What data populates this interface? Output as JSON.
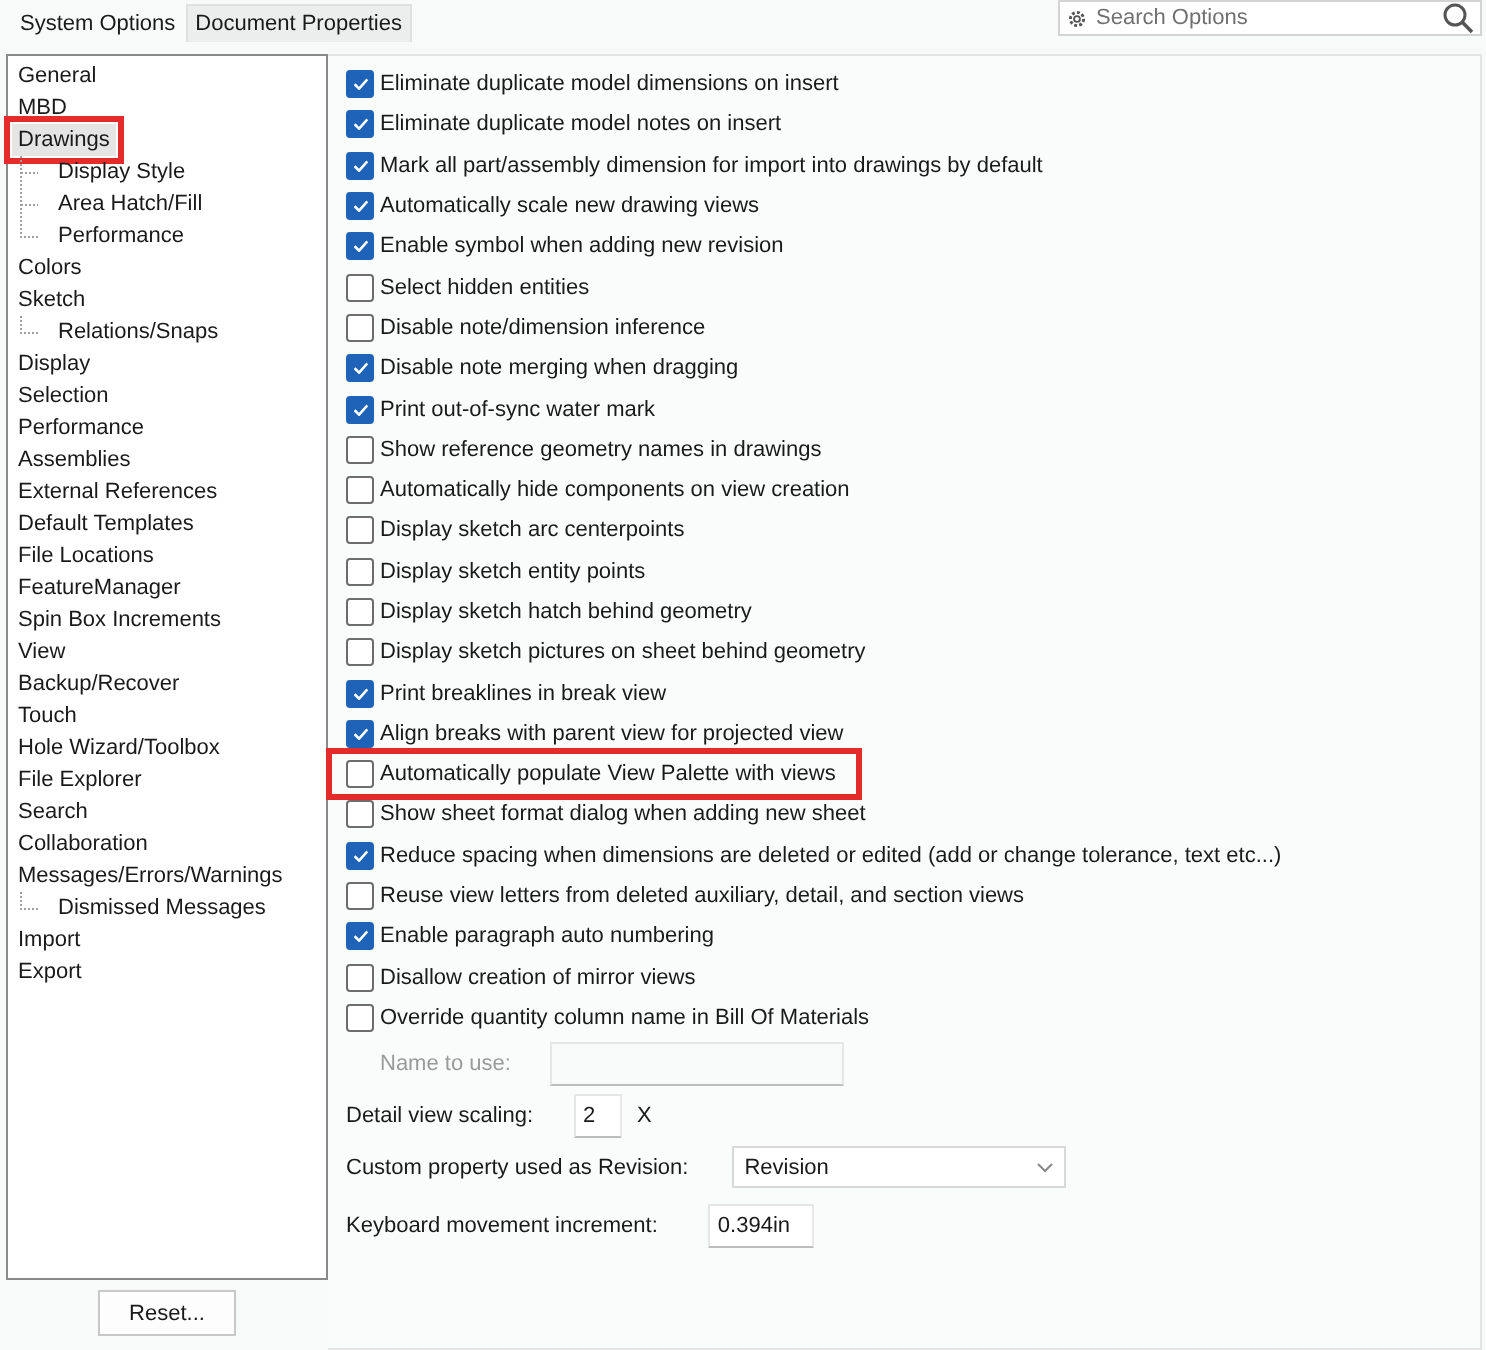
{
  "tabs": [
    {
      "label": "System Options",
      "selected": true
    },
    {
      "label": "Document Properties",
      "selected": false
    }
  ],
  "search": {
    "placeholder": "Search Options"
  },
  "sidebar": {
    "items": [
      {
        "label": "General",
        "selected": false,
        "highlighted": false
      },
      {
        "label": "MBD",
        "selected": false,
        "highlighted": false
      },
      {
        "label": "Drawings",
        "selected": true,
        "highlighted": true,
        "children": [
          {
            "label": "Display Style",
            "selected": false,
            "highlighted": false
          },
          {
            "label": "Area Hatch/Fill",
            "selected": false,
            "highlighted": false
          },
          {
            "label": "Performance",
            "selected": false,
            "highlighted": false
          }
        ]
      },
      {
        "label": "Colors",
        "selected": false,
        "highlighted": false
      },
      {
        "label": "Sketch",
        "selected": false,
        "highlighted": false,
        "children": [
          {
            "label": "Relations/Snaps",
            "selected": false,
            "highlighted": false
          }
        ]
      },
      {
        "label": "Display",
        "selected": false,
        "highlighted": false
      },
      {
        "label": "Selection",
        "selected": false,
        "highlighted": false
      },
      {
        "label": "Performance",
        "selected": false,
        "highlighted": false
      },
      {
        "label": "Assemblies",
        "selected": false,
        "highlighted": false
      },
      {
        "label": "External References",
        "selected": false,
        "highlighted": false
      },
      {
        "label": "Default Templates",
        "selected": false,
        "highlighted": false
      },
      {
        "label": "File Locations",
        "selected": false,
        "highlighted": false
      },
      {
        "label": "FeatureManager",
        "selected": false,
        "highlighted": false
      },
      {
        "label": "Spin Box Increments",
        "selected": false,
        "highlighted": false
      },
      {
        "label": "View",
        "selected": false,
        "highlighted": false
      },
      {
        "label": "Backup/Recover",
        "selected": false,
        "highlighted": false
      },
      {
        "label": "Touch",
        "selected": false,
        "highlighted": false
      },
      {
        "label": "Hole Wizard/Toolbox",
        "selected": false,
        "highlighted": false
      },
      {
        "label": "File Explorer",
        "selected": false,
        "highlighted": false
      },
      {
        "label": "Search",
        "selected": false,
        "highlighted": false
      },
      {
        "label": "Collaboration",
        "selected": false,
        "highlighted": false
      },
      {
        "label": "Messages/Errors/Warnings",
        "selected": false,
        "highlighted": false,
        "children": [
          {
            "label": "Dismissed Messages",
            "selected": false,
            "highlighted": false
          }
        ]
      },
      {
        "label": "Import",
        "selected": false,
        "highlighted": false
      },
      {
        "label": "Export",
        "selected": false,
        "highlighted": false
      }
    ]
  },
  "options": [
    {
      "label": "Eliminate duplicate model dimensions on insert",
      "checked": true,
      "highlighted": false
    },
    {
      "label": "Eliminate duplicate model notes on insert",
      "checked": true,
      "highlighted": false
    },
    {
      "label": "Mark all part/assembly dimension for import into drawings by default",
      "checked": true,
      "highlighted": false
    },
    {
      "label": "Automatically scale new drawing views",
      "checked": true,
      "highlighted": false
    },
    {
      "label": "Enable symbol when adding new revision",
      "checked": true,
      "highlighted": false
    },
    {
      "label": "Select hidden entities",
      "checked": false,
      "highlighted": false
    },
    {
      "label": "Disable note/dimension inference",
      "checked": false,
      "highlighted": false
    },
    {
      "label": "Disable note merging when dragging",
      "checked": true,
      "highlighted": false
    },
    {
      "label": "Print out-of-sync water mark",
      "checked": true,
      "highlighted": false
    },
    {
      "label": "Show reference geometry names in drawings",
      "checked": false,
      "highlighted": false
    },
    {
      "label": "Automatically hide components on view creation",
      "checked": false,
      "highlighted": false
    },
    {
      "label": "Display sketch arc centerpoints",
      "checked": false,
      "highlighted": false
    },
    {
      "label": "Display sketch entity points",
      "checked": false,
      "highlighted": false
    },
    {
      "label": "Display sketch hatch behind geometry",
      "checked": false,
      "highlighted": false
    },
    {
      "label": "Display sketch pictures on sheet behind geometry",
      "checked": false,
      "highlighted": false
    },
    {
      "label": "Print breaklines in break view",
      "checked": true,
      "highlighted": false
    },
    {
      "label": "Align breaks with parent view for projected view",
      "checked": true,
      "highlighted": false
    },
    {
      "label": "Automatically populate View Palette with views",
      "checked": false,
      "highlighted": true
    },
    {
      "label": "Show sheet format dialog when adding new sheet",
      "checked": false,
      "highlighted": false
    },
    {
      "label": "Reduce spacing when dimensions are deleted or edited (add or change tolerance, text etc...)",
      "checked": true,
      "highlighted": false
    },
    {
      "label": "Reuse view letters from deleted auxiliary, detail, and section views",
      "checked": false,
      "highlighted": false
    },
    {
      "label": "Enable paragraph auto numbering",
      "checked": true,
      "highlighted": false
    },
    {
      "label": "Disallow creation of mirror views",
      "checked": false,
      "highlighted": false
    },
    {
      "label": "Override quantity column name in Bill Of Materials",
      "checked": false,
      "highlighted": false
    }
  ],
  "name_to_use": {
    "label": "Name to use:",
    "disabled": true
  },
  "detail_view_scaling": {
    "label": "Detail view scaling:",
    "value": "2",
    "unit": "X"
  },
  "revision_property": {
    "label": "Custom property used as Revision:",
    "value": "Revision"
  },
  "keyboard_increment": {
    "label": "Keyboard movement increment:",
    "value": "0.394in"
  },
  "reset_button": "Reset..."
}
